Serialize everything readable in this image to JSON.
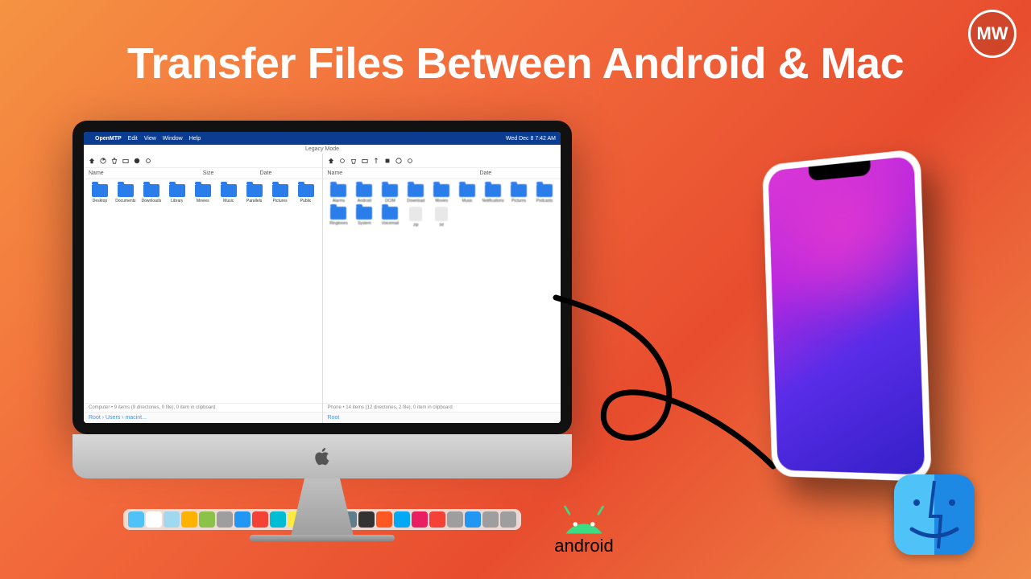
{
  "title": "Transfer Files Between Android & Mac",
  "badge": "MW",
  "menubar": {
    "app": "OpenMTP",
    "items": [
      "Edit",
      "View",
      "Window",
      "Help"
    ],
    "clock": "Wed Dec 8  7:42 AM"
  },
  "mode_label": "Legacy Mode",
  "left_pane": {
    "headers": [
      "Name",
      "Size",
      "Date"
    ],
    "folders": [
      "Desktop",
      "Documents",
      "Downloads",
      "Library",
      "Movies",
      "Music",
      "Parallels",
      "Pictures",
      "Public"
    ],
    "status": "Computer • 9 items (9 directories, 0 file), 0 item in clipboard",
    "breadcrumb": "Root  ›  Users  ›  macint..."
  },
  "right_pane": {
    "headers": [
      "Name",
      "Date"
    ],
    "folders_row1": [
      "Alarms",
      "Android",
      "DCIM",
      "Download",
      "Movies",
      "Music",
      "Notifications",
      "Pictures",
      "Podcasts"
    ],
    "folders_row2": [
      "Ringtones",
      "System",
      "Voicemail"
    ],
    "files": [
      "zip",
      "txt"
    ],
    "status": "Phone • 14 items (12 directories, 2 file), 0 item in clipboard",
    "breadcrumb": "Root"
  },
  "android_label": "android",
  "dock_colors": [
    "#4fc3f7",
    "#fff",
    "#a0d8f0",
    "#ffb300",
    "#8bc34a",
    "#9e9e9e",
    "#2196f3",
    "#f44336",
    "#00bcd4",
    "#ffeb3b",
    "#fff",
    "#9c27b0",
    "#607d8b",
    "#333",
    "#ff5722",
    "#03a9f4",
    "#e91e63",
    "#f44336",
    "#9e9e9e",
    "#2196f3",
    "#9e9e9e",
    "#9e9e9e"
  ]
}
